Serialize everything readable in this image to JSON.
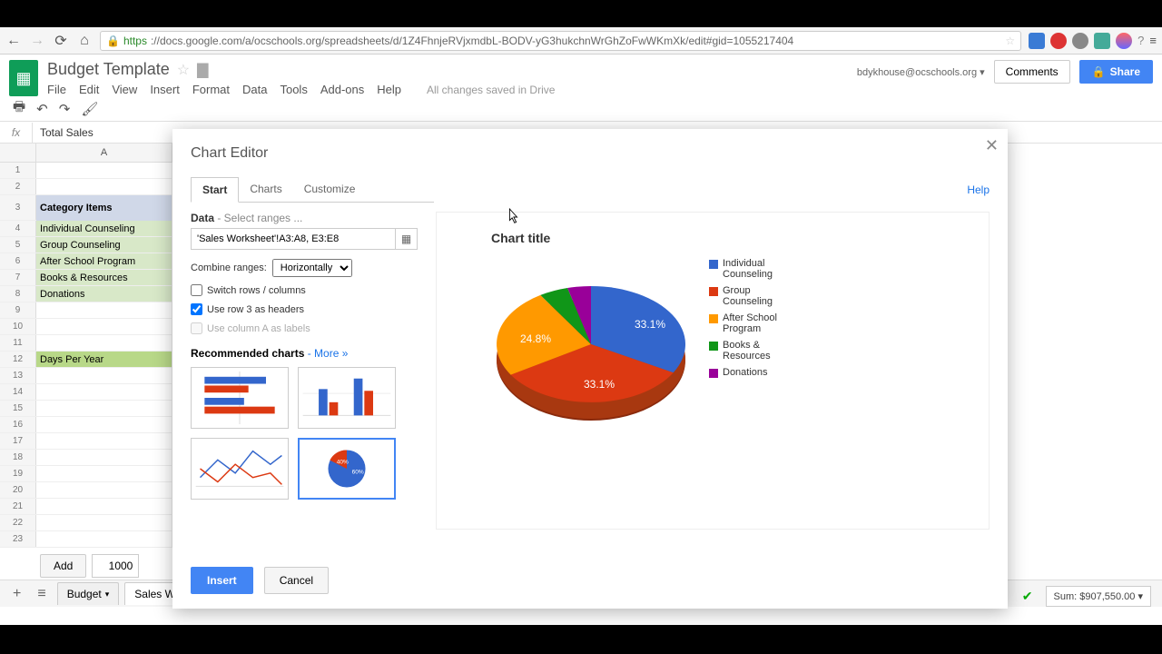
{
  "browser": {
    "url_https": "https",
    "url_rest": "://docs.google.com/a/ocschools.org/spreadsheets/d/1Z4FhnjeRVjxmdbL-BODV-yG3hukchnWrGhZoFwWKmXk/edit#gid=1055217404"
  },
  "doc": {
    "title": "Budget Template",
    "user": "bdykhouse@ocschools.org ▾",
    "comments": "Comments",
    "share": "Share",
    "saved": "All changes saved in Drive",
    "menus": [
      "File",
      "Edit",
      "View",
      "Insert",
      "Format",
      "Data",
      "Tools",
      "Add-ons",
      "Help"
    ]
  },
  "formula": {
    "fx": "fx",
    "value": "Total Sales"
  },
  "sheet": {
    "col": "A",
    "rows": [
      {
        "n": "1",
        "v": ""
      },
      {
        "n": "2",
        "v": ""
      },
      {
        "n": "3",
        "v": "Category Items",
        "cls": "header"
      },
      {
        "n": "4",
        "v": "Individual Counseling",
        "cls": "green"
      },
      {
        "n": "5",
        "v": "Group Counseling",
        "cls": "green"
      },
      {
        "n": "6",
        "v": "After School Program",
        "cls": "green"
      },
      {
        "n": "7",
        "v": "Books & Resources",
        "cls": "green"
      },
      {
        "n": "8",
        "v": "Donations",
        "cls": "green"
      },
      {
        "n": "9",
        "v": ""
      },
      {
        "n": "10",
        "v": ""
      },
      {
        "n": "11",
        "v": ""
      },
      {
        "n": "12",
        "v": "Days Per Year",
        "cls": "dgreen"
      },
      {
        "n": "13",
        "v": ""
      },
      {
        "n": "14",
        "v": ""
      },
      {
        "n": "15",
        "v": ""
      },
      {
        "n": "16",
        "v": ""
      },
      {
        "n": "17",
        "v": ""
      },
      {
        "n": "18",
        "v": ""
      },
      {
        "n": "19",
        "v": ""
      },
      {
        "n": "20",
        "v": ""
      },
      {
        "n": "21",
        "v": ""
      },
      {
        "n": "22",
        "v": ""
      },
      {
        "n": "23",
        "v": ""
      }
    ],
    "add_label": "Add",
    "add_count": "1000",
    "tabs": [
      "Budget",
      "Sales Worksheet"
    ],
    "sum": "Sum: $907,550.00 ▾"
  },
  "dialog": {
    "title": "Chart Editor",
    "tabs": [
      "Start",
      "Charts",
      "Customize"
    ],
    "help": "Help",
    "data_label": "Data",
    "data_hint": " - Select ranges ...",
    "range": "'Sales Worksheet'!A3:A8, E3:E8",
    "combine_label": "Combine ranges:",
    "combine_value": "Horizontally",
    "switch": "Switch rows / columns",
    "use_row": "Use row 3 as headers",
    "use_col": "Use column A as labels",
    "rec_title": "Recommended charts",
    "rec_more": " - More »",
    "insert": "Insert",
    "cancel": "Cancel"
  },
  "chart_data": {
    "type": "pie",
    "title": "Chart title",
    "categories": [
      "Individual Counseling",
      "Group Counseling",
      "After School Program",
      "Books & Resources",
      "Donations"
    ],
    "values": [
      33.1,
      33.1,
      24.8,
      5.0,
      4.0
    ],
    "labels_shown": [
      "33.1%",
      "33.1%",
      "24.8%"
    ],
    "colors": [
      "#3366cc",
      "#dc3912",
      "#ff9900",
      "#109618",
      "#990099"
    ]
  }
}
